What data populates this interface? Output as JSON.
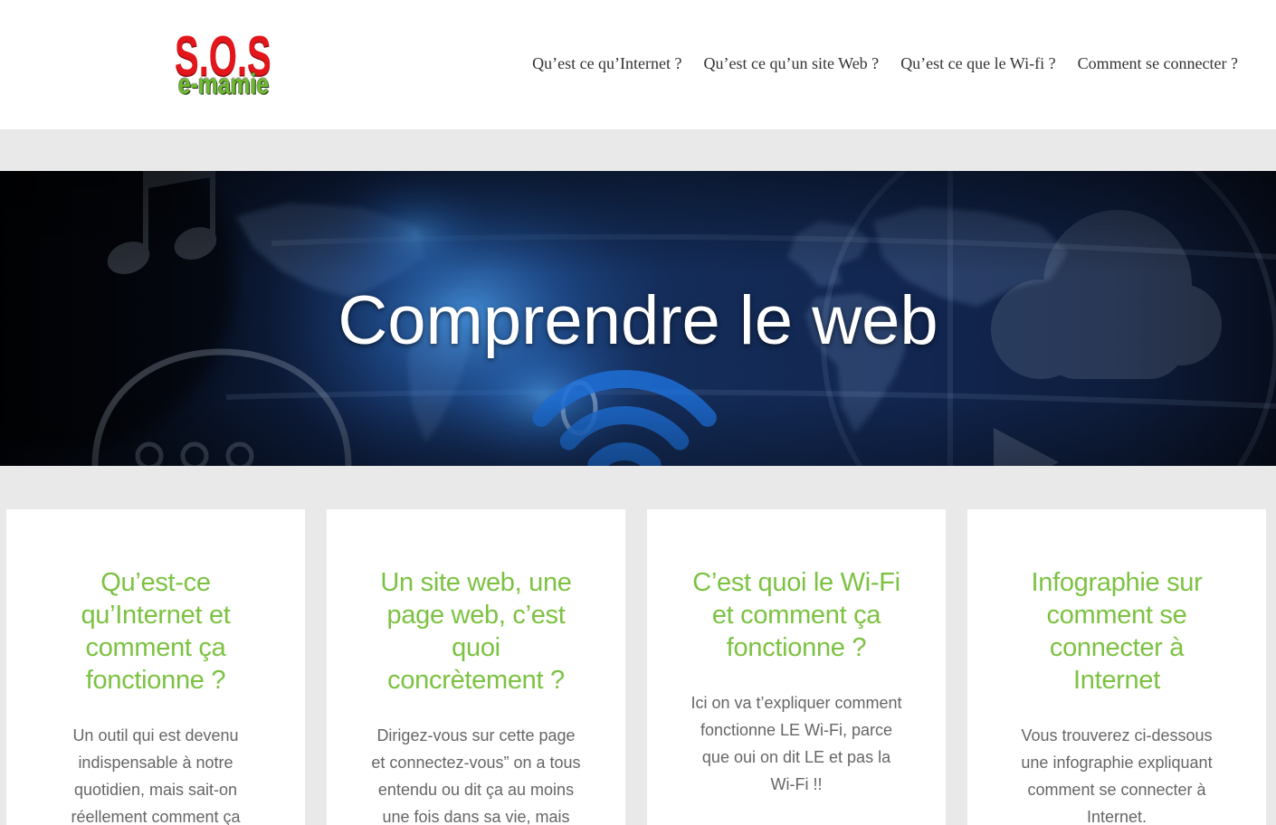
{
  "header": {
    "logo": {
      "main": "S.O.S",
      "sub": "e-mamie"
    },
    "nav": [
      {
        "label": "Qu’est ce qu’Internet ?"
      },
      {
        "label": "Qu’est ce qu’un site Web ?"
      },
      {
        "label": "Qu’est ce que le Wi-fi ?"
      },
      {
        "label": "Comment se connecter ?"
      }
    ]
  },
  "hero": {
    "title": "Comprendre le web",
    "decor_icons": [
      "music-note-icon",
      "chat-bubble-icon",
      "wifi-icon",
      "cloud-icon",
      "play-icon",
      "world-map-graphic"
    ]
  },
  "cards": [
    {
      "title": "Qu’est-ce\nqu’Internet et\ncomment ça\nfonctionne ?",
      "text": "Un outil qui est devenu\nindispensable à notre\nquotidien, mais sait-on\nréellement comment ça"
    },
    {
      "title": "Un site web, une\npage web, c’est\nquoi\nconcrètement ?",
      "text": "Dirigez-vous sur cette page\net connectez-vous” on a tous\nentendu ou dit ça au moins\nune fois dans sa vie, mais"
    },
    {
      "title": "C’est quoi le Wi-Fi\net comment ça\nfonctionne ?",
      "text": "Ici on va t’expliquer comment\nfonctionne LE Wi-Fi, parce\nque oui on dit LE et pas la\nWi-Fi !!"
    },
    {
      "title": "Infographie sur\ncomment se\nconnecter à\nInternet",
      "text": "Vous trouverez ci-dessous\nune infographie expliquant\ncomment se connecter à\nInternet."
    }
  ],
  "colors": {
    "accent": "#7cc242",
    "logo_red": "#e3161b",
    "logo_green": "#6dbb2c",
    "nav_text": "#333333",
    "body_text": "#666666",
    "page_background": "#e9e9e9"
  }
}
